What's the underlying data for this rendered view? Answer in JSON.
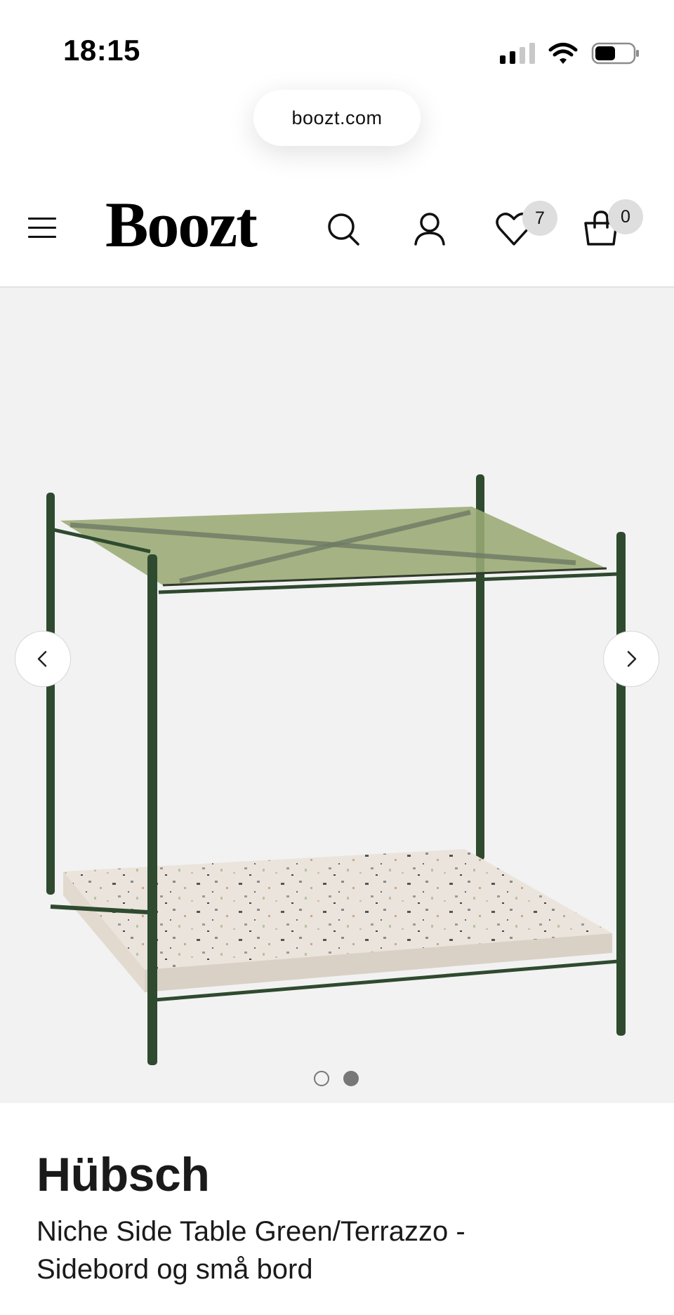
{
  "status_bar": {
    "time": "18:15",
    "icons": [
      "signal-icon",
      "wifi-icon",
      "battery-icon"
    ]
  },
  "browser": {
    "url": "boozt.com"
  },
  "header": {
    "logo": "Boozt",
    "icons": [
      "menu-icon",
      "search-icon",
      "user-icon",
      "heart-icon",
      "bag-icon"
    ],
    "wishlist_count": "7",
    "cart_count": "0"
  },
  "gallery": {
    "image_count": 2,
    "active_index": 2,
    "controls": [
      "chevron-left-icon",
      "chevron-right-icon"
    ]
  },
  "product": {
    "brand": "Hübsch",
    "name": "Niche Side Table Green/Terrazzo - Sidebord og små bord"
  },
  "colors": {
    "background": "#ffffff",
    "gallery_bg": "#f2f2f2",
    "text": "#111111",
    "badge_bg": "#dedede",
    "frame_green": "#2f4a2f",
    "glass_green": "#9aaa74",
    "terrazzo": "#ebe4dc"
  }
}
